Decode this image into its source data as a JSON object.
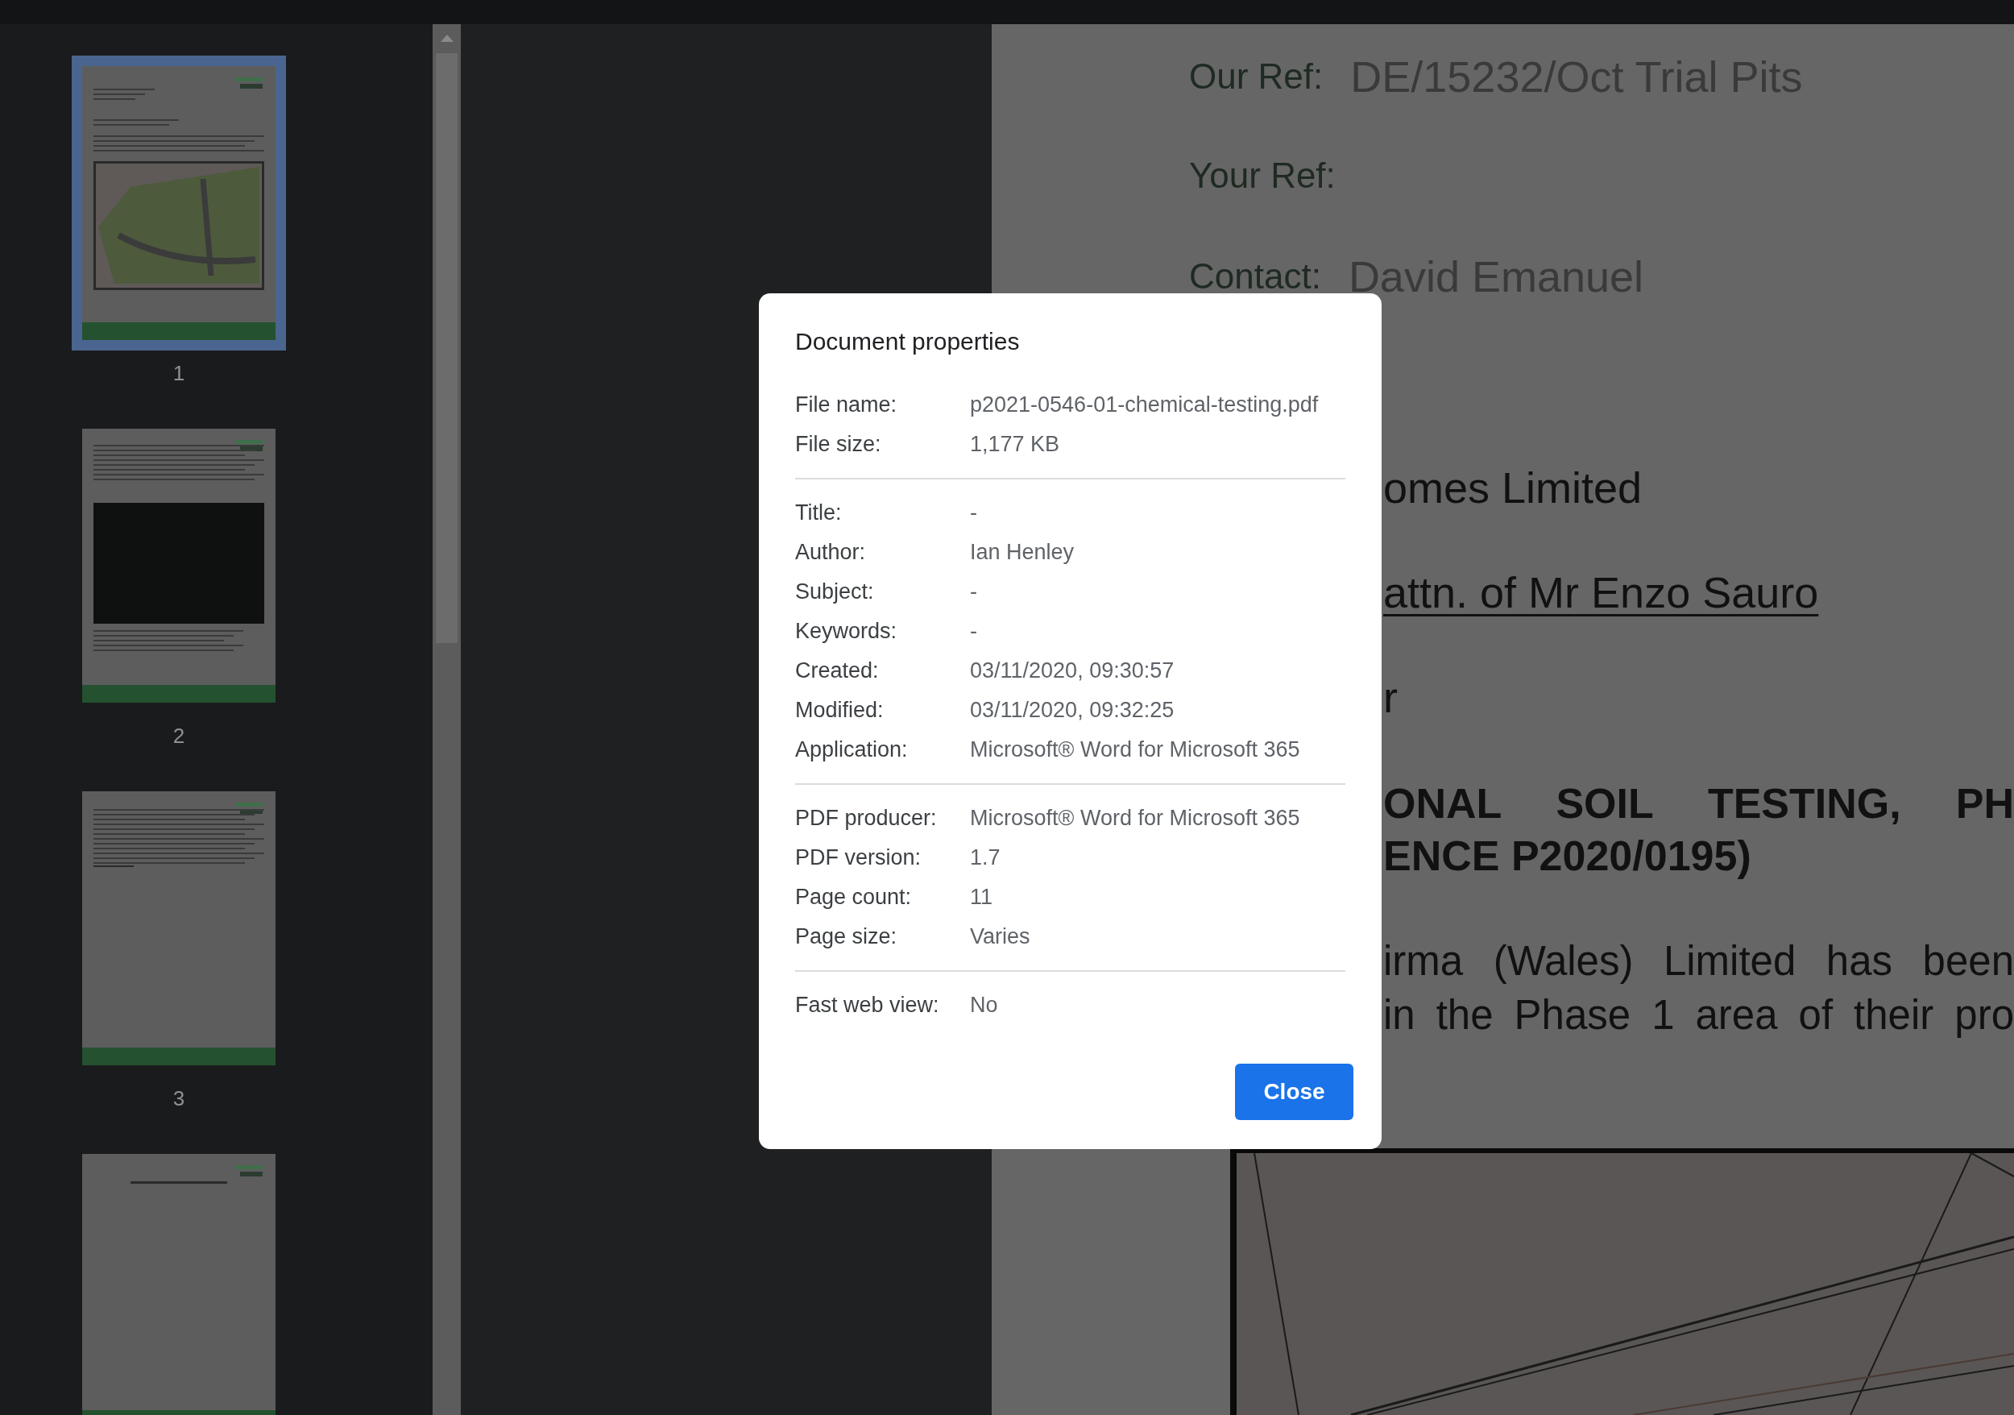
{
  "sidebar": {
    "thumbnails": [
      {
        "page": "1",
        "selected": true,
        "kind": "plan"
      },
      {
        "page": "2",
        "selected": false,
        "kind": "table"
      },
      {
        "page": "3",
        "selected": false,
        "kind": "text"
      },
      {
        "selected": false,
        "kind": "title"
      }
    ]
  },
  "document": {
    "lines": [
      {
        "kind": "ref",
        "label": "Our Ref:",
        "value": "DE/15232/Oct Trial Pits"
      },
      {
        "kind": "ref",
        "label": "Your Ref:"
      },
      {
        "kind": "ref",
        "label": "Contact:",
        "value": "David Emanuel"
      },
      {
        "kind": "plain",
        "text": "omes Limited"
      },
      {
        "kind": "underlined",
        "text": "attn. of Mr Enzo Sauro"
      },
      {
        "kind": "plain",
        "text": "r"
      },
      {
        "kind": "heading",
        "text": "ONAL SOIL TESTING, PH"
      },
      {
        "kind": "heading-last",
        "text": "ENCE P2020/0195)"
      },
      {
        "kind": "justified",
        "text": "irma (Wales) Limited has been"
      },
      {
        "kind": "justified",
        "text": "in the Phase 1 area of their pro"
      }
    ]
  },
  "dialog": {
    "title": "Document properties",
    "groups": [
      [
        {
          "label": "File name:",
          "value": "p2021-0546-01-chemical-testing.pdf"
        },
        {
          "label": "File size:",
          "value": "1,177 KB"
        }
      ],
      [
        {
          "label": "Title:",
          "value": "-"
        },
        {
          "label": "Author:",
          "value": "Ian Henley"
        },
        {
          "label": "Subject:",
          "value": "-"
        },
        {
          "label": "Keywords:",
          "value": "-"
        },
        {
          "label": "Created:",
          "value": "03/11/2020, 09:30:57"
        },
        {
          "label": "Modified:",
          "value": "03/11/2020, 09:32:25"
        },
        {
          "label": "Application:",
          "value": "Microsoft® Word for Microsoft 365"
        }
      ],
      [
        {
          "label": "PDF producer:",
          "value": "Microsoft® Word for Microsoft 365"
        },
        {
          "label": "PDF version:",
          "value": "1.7"
        },
        {
          "label": "Page count:",
          "value": "11"
        },
        {
          "label": "Page size:",
          "value": "Varies"
        }
      ],
      [
        {
          "label": "Fast web view:",
          "value": "No"
        }
      ]
    ],
    "button": "Close"
  }
}
